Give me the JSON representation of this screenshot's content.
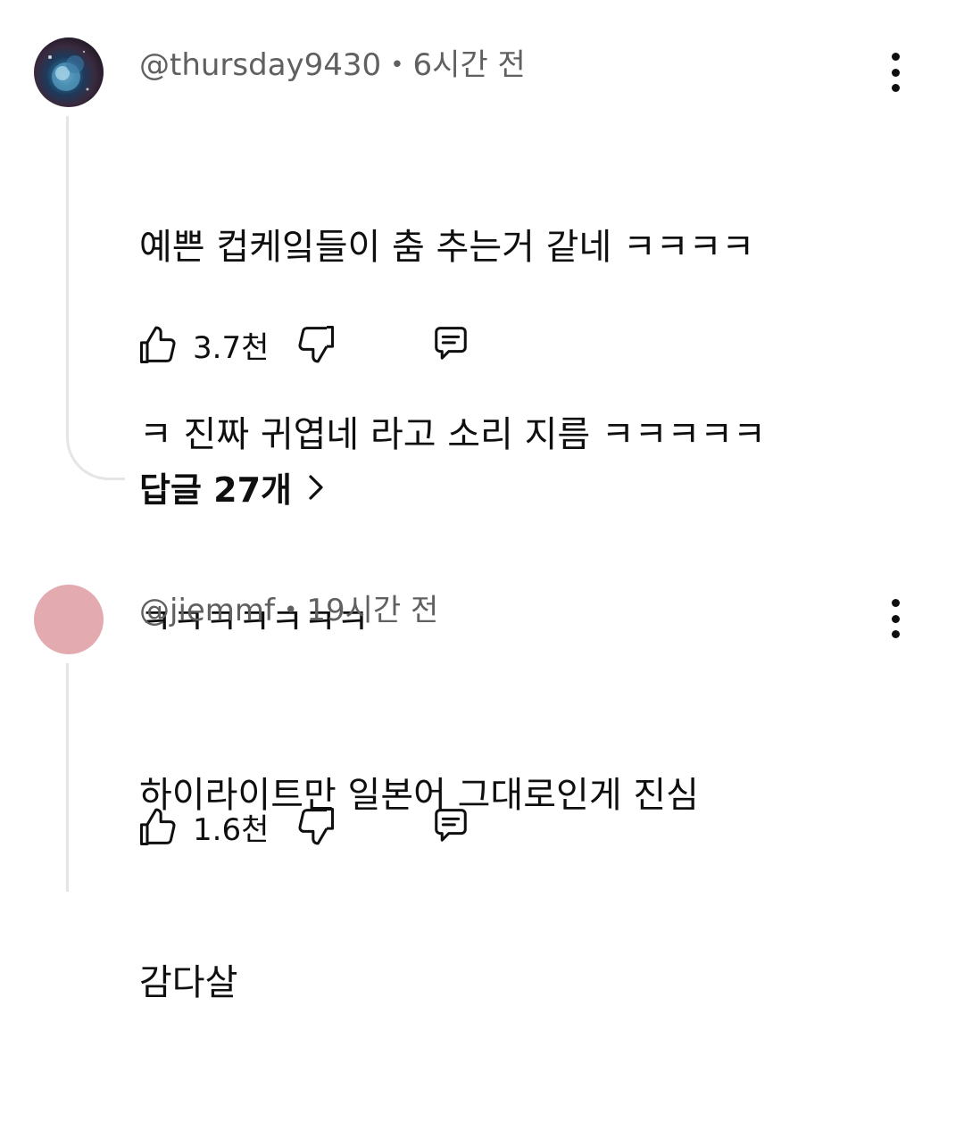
{
  "comments": [
    {
      "handle": "@thursday9430",
      "time": "6시간 전",
      "avatar": "space-nebula-avatar",
      "lines": [
        "예쁜 컵케잌들이 춤 추는거 같네 ㅋㅋㅋㅋ",
        "ㅋ 진짜 귀엽네 라고 소리 지름 ㅋㅋㅋㅋㅋ",
        "ㅋㅋㅋㅋㅋㅋㅋ"
      ],
      "likes": "3.7천",
      "replies_label": "답글 27개"
    },
    {
      "handle": "@jiemmf",
      "time": "19시간 전",
      "avatar_color": "#e3aab0",
      "lines": [
        "하이라이트만 일본어 그대로인게 진심",
        "감다살"
      ],
      "likes": "1.6천"
    }
  ],
  "separator": "•",
  "icons": {
    "like": "thumbs-up-icon",
    "dislike": "thumbs-down-icon",
    "reply": "comment-icon",
    "more": "more-vertical-icon",
    "chevron": "chevron-right-icon"
  }
}
